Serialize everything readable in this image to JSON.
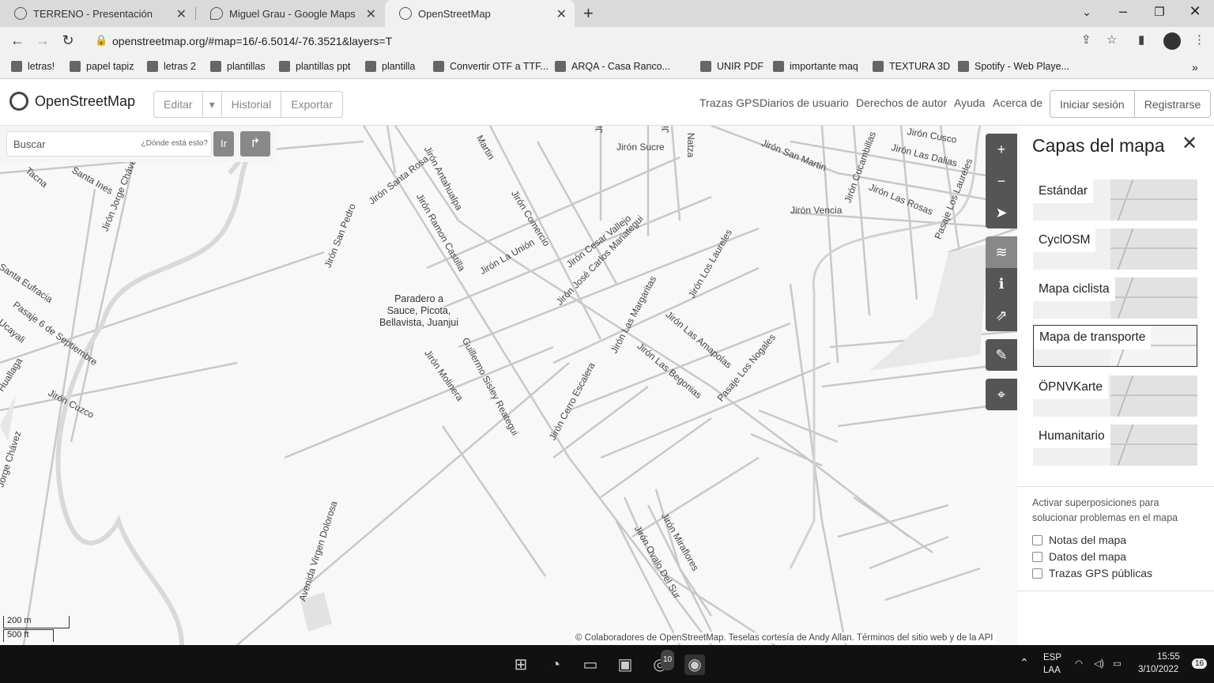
{
  "browser": {
    "tabs": [
      {
        "title": "TERRENO - Presentación",
        "icon": "canva-icon"
      },
      {
        "title": "Miguel Grau - Google Maps",
        "icon": "maps-icon"
      },
      {
        "title": "OpenStreetMap",
        "icon": "osm-icon",
        "active": true
      }
    ],
    "url": "openstreetmap.org/#map=16/-6.5014/-76.3521&layers=T",
    "bookmarks": [
      "letras!",
      "papel tapiz",
      "letras 2",
      "plantillas",
      "plantillas ppt",
      "plantilla",
      "Convertir OTF a TTF...",
      "ARQA - Casa Ranco...",
      "UNIR PDF",
      "importante maq",
      "TEXTURA 3D",
      "Spotify - Web Playe..."
    ]
  },
  "header": {
    "logo": "OpenStreetMap",
    "edit": "Editar",
    "history": "Historial",
    "export": "Exportar",
    "links": [
      "Trazas GPS",
      "Diarios de usuario",
      "Derechos de autor",
      "Ayuda",
      "Acerca de"
    ],
    "login": "Iniciar sesión",
    "register": "Registrarse"
  },
  "search": {
    "placeholder": "Buscar",
    "where": "¿Dónde está esto?",
    "go": "Ir"
  },
  "map": {
    "streets": [
      "Jirón Antahualpa",
      "Jirón Santa Rosa",
      "Jirón Ramon Castilla",
      "Jirón Comercio",
      "Jirón La Unión",
      "Jirón Cesar Vallejo",
      "Jirón José Carlos Mariategui",
      "Jirón San Pedro",
      "Jirón Jorge Chávez",
      "Jirón Sucre",
      "Jirón San Martin",
      "Jirón Cucambillas",
      "Jirón Las Dalias",
      "Jirón Las Rosas",
      "Jirón Vencia",
      "Pasaje Los Laureles",
      "Jirón Los Laureles",
      "Jirón Las Margaritas",
      "Jirón Las Amapolas",
      "Jirón Las Begonias",
      "Pasaje Los Nogales",
      "Jirón Cerro Escalera",
      "Guillermo Sisley Reategui",
      "Jirón Molinera",
      "Jirón Cuzco",
      "Pasaje 6 de Septiembre",
      "Santa Eufracia",
      "Ucayali",
      "Huallaga",
      "Avenida Virgen Dolorosa",
      "Jirón Miraflores",
      "Jirón Ovalo Del Sur",
      "Martin",
      "Natza",
      "Jirón Si",
      "Jirón",
      "Santa Ines",
      "Jorge Chávez",
      "Tacna",
      "Jirón Cusco"
    ],
    "poi": [
      "Paradero a",
      "Sauce, Picota,",
      "Bellavista, Juanjui"
    ],
    "scale": {
      "metric": "200 m",
      "imperial": "500 ft"
    },
    "attribution": {
      "contributors": "© Colaboradores de OpenStreetMap",
      "tiles_prefix": "Teselas cortesía de",
      "tiles_author": "Andy Allan",
      "terms": "Términos del sitio web y de la API"
    }
  },
  "layers_panel": {
    "title": "Capas del mapa",
    "layers": [
      "Estándar",
      "CyclOSM",
      "Mapa ciclista",
      "Mapa de transporte",
      "ÖPNVKarte",
      "Humanitario"
    ],
    "selected": "Mapa de transporte",
    "overlay_text": "Activar superposiciones para solucionar problemas en el mapa",
    "overlays": [
      "Notas del mapa",
      "Datos del mapa",
      "Trazas GPS públicas"
    ]
  },
  "taskbar": {
    "whatsapp_badge": "10",
    "lang": "ESP",
    "region": "LAA",
    "time": "15:55",
    "date": "3/10/2022",
    "notifications": "16"
  }
}
